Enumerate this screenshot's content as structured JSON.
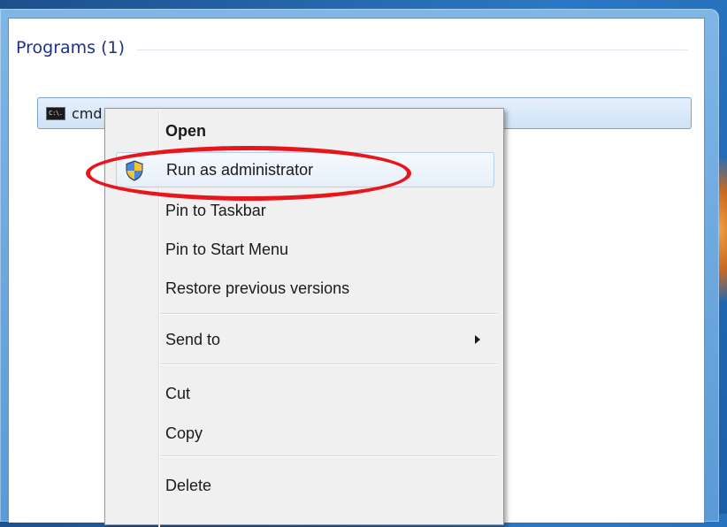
{
  "section": {
    "title": "Programs (1)"
  },
  "program_item": {
    "label": "cmd",
    "icon": "console-window-icon",
    "icon_text": "C:\\."
  },
  "context_menu": {
    "items": [
      {
        "id": "open",
        "label": "Open",
        "bold": true
      },
      {
        "id": "run-as-admin",
        "label": "Run as administrator",
        "icon": "uac-shield-icon",
        "hovered": true
      },
      {
        "id": "pin-taskbar",
        "label": "Pin to Taskbar"
      },
      {
        "id": "pin-start",
        "label": "Pin to Start Menu"
      },
      {
        "id": "restore",
        "label": "Restore previous versions"
      },
      {
        "id": "send-to",
        "label": "Send to",
        "submenu": true
      },
      {
        "id": "cut",
        "label": "Cut"
      },
      {
        "id": "copy",
        "label": "Copy"
      },
      {
        "id": "delete",
        "label": "Delete"
      }
    ]
  },
  "annotation": {
    "highlight_color": "#e8151b",
    "target": "run-as-admin"
  },
  "colors": {
    "section_title": "#1e3287",
    "selection_border": "#7da2ce",
    "menu_background": "#f0f0f0"
  }
}
